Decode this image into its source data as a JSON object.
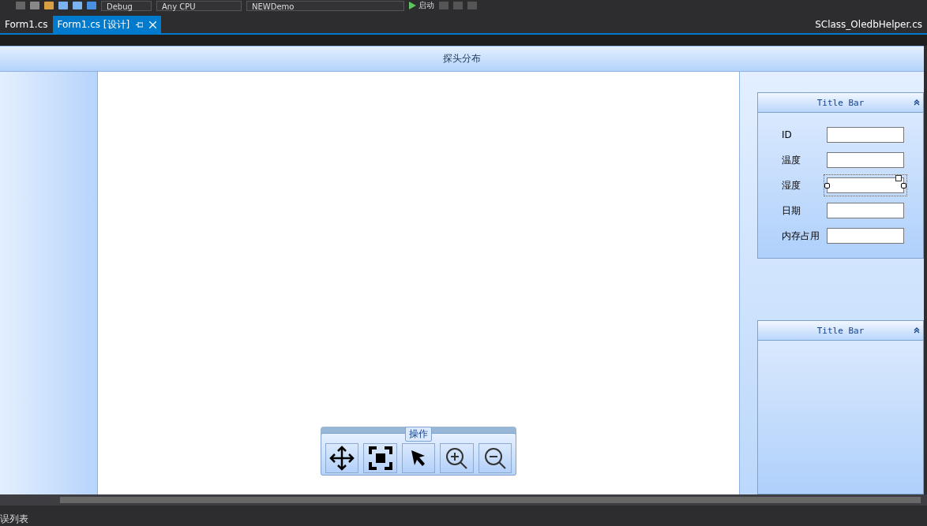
{
  "toolbar": {
    "configuration": "Debug",
    "platform": "Any CPU",
    "project": "NEWDemo",
    "start": "启动"
  },
  "tabs": [
    {
      "label": "Form1.cs",
      "selected": false,
      "pinnable": false
    },
    {
      "label": "Form1.cs [设计]",
      "selected": true,
      "pinnable": true
    },
    {
      "label": "SClass_OledbHelper.cs",
      "selected": false,
      "pinnable": false
    }
  ],
  "form": {
    "title": "探头分布",
    "panels": [
      {
        "title": "Title Bar",
        "fields": [
          {
            "label": "ID",
            "selected": false
          },
          {
            "label": "温度",
            "selected": false
          },
          {
            "label": "湿度",
            "selected": true
          },
          {
            "label": "日期",
            "selected": false
          },
          {
            "label": "内存占用",
            "selected": false
          }
        ]
      },
      {
        "title": "Title Bar"
      }
    ],
    "tools": {
      "title": "操作",
      "buttons": [
        {
          "kind": "move"
        },
        {
          "kind": "fit"
        },
        {
          "kind": "pointer"
        },
        {
          "kind": "zoom-in"
        },
        {
          "kind": "zoom-out"
        }
      ]
    }
  },
  "bottom_panel": {
    "title": "误列表"
  }
}
